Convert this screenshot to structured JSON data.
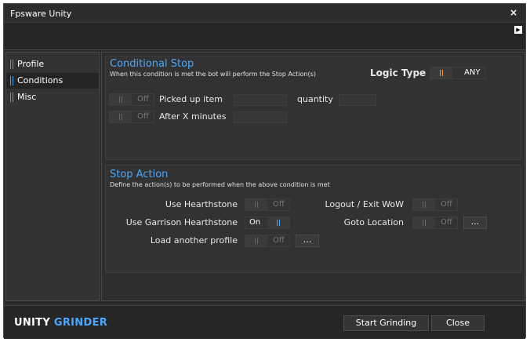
{
  "window": {
    "title": "Fpsware Unity",
    "close_glyph": "×"
  },
  "sidebar": {
    "items": [
      {
        "label": "Profile",
        "active": false
      },
      {
        "label": "Conditions",
        "active": true
      },
      {
        "label": "Misc",
        "active": false
      }
    ]
  },
  "conditional_stop": {
    "title": "Conditional Stop",
    "description": "When this condition is met the bot will perform the Stop Action(s)",
    "logic_type_label": "Logic Type",
    "logic_type_value": "ANY",
    "rows": [
      {
        "toggle_text": "Off",
        "label": "Picked up item",
        "extra_label": "quantity"
      },
      {
        "toggle_text": "Off",
        "label": "After X minutes"
      }
    ]
  },
  "stop_action": {
    "title": "Stop Action",
    "description": "Define the action(s) to be performed when the above condition is met",
    "use_hearthstone": {
      "label": "Use Hearthstone",
      "state": "Off"
    },
    "use_garrison_hearthstone": {
      "label": "Use Garrison Hearthstone",
      "state": "On"
    },
    "load_another_profile": {
      "label": "Load another profile",
      "state": "Off",
      "button": "..."
    },
    "logout_exit": {
      "label": "Logout / Exit WoW",
      "state": "Off"
    },
    "goto_location": {
      "label": "Goto Location",
      "state": "Off",
      "button": "..."
    }
  },
  "footer": {
    "brand_part1": "UNITY",
    "brand_part2": "GRINDER",
    "start_button": "Start Grinding",
    "close_button": "Close"
  },
  "colors": {
    "accent": "#4aa8ff",
    "logic_accent": "#ff9a2a",
    "background": "#2b2b2b"
  },
  "icons": {
    "collapse": "chevron-right-icon"
  }
}
